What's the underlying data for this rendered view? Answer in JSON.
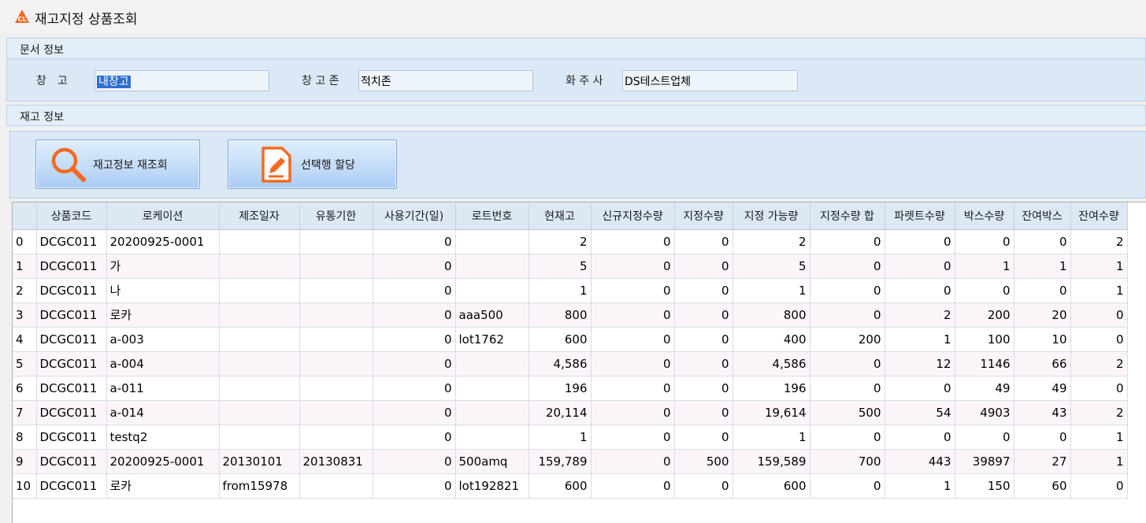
{
  "window": {
    "title": "재고지정 상품조회"
  },
  "doc_section": {
    "label": "문서 정보",
    "fields": [
      {
        "label": "창　고",
        "value": "내창고"
      },
      {
        "label": "창 고 존",
        "value": "적치존"
      },
      {
        "label": "화 주 사",
        "value": "DS테스트업체"
      }
    ]
  },
  "stock_section": {
    "label": "재고 정보",
    "buttons": {
      "requery": "재고정보 재조회",
      "assign": "선택행 할당"
    }
  },
  "colors": {
    "accent": "#f26a21",
    "selection": "#2d6fd2",
    "header_bg": "#dde8f5"
  },
  "table": {
    "columns": [
      "",
      "상품코드",
      "로케이션",
      "제조일자",
      "유통기한",
      "사용기간(일)",
      "로트번호",
      "현재고",
      "신규지정수량",
      "지정수량",
      "지정 가능량",
      "지정수량 합",
      "파렛트수량",
      "박스수량",
      "잔여박스",
      "잔여수량"
    ],
    "rows": [
      [
        "0",
        "DCGC011",
        "20200925-0001",
        "",
        "",
        "0",
        "",
        "2",
        "0",
        "0",
        "2",
        "0",
        "0",
        "0",
        "0",
        "2"
      ],
      [
        "1",
        "DCGC011",
        "가",
        "",
        "",
        "0",
        "",
        "5",
        "0",
        "0",
        "5",
        "0",
        "0",
        "1",
        "1",
        "1"
      ],
      [
        "2",
        "DCGC011",
        "나",
        "",
        "",
        "0",
        "",
        "1",
        "0",
        "0",
        "1",
        "0",
        "0",
        "0",
        "0",
        "1"
      ],
      [
        "3",
        "DCGC011",
        "로카",
        "",
        "",
        "0",
        "aaa500",
        "800",
        "0",
        "0",
        "800",
        "0",
        "2",
        "200",
        "20",
        "0"
      ],
      [
        "4",
        "DCGC011",
        "a-003",
        "",
        "",
        "0",
        "lot1762",
        "600",
        "0",
        "0",
        "400",
        "200",
        "1",
        "100",
        "10",
        "0"
      ],
      [
        "5",
        "DCGC011",
        "a-004",
        "",
        "",
        "0",
        "",
        "4,586",
        "0",
        "0",
        "4,586",
        "0",
        "12",
        "1146",
        "66",
        "2"
      ],
      [
        "6",
        "DCGC011",
        "a-011",
        "",
        "",
        "0",
        "",
        "196",
        "0",
        "0",
        "196",
        "0",
        "0",
        "49",
        "49",
        "0"
      ],
      [
        "7",
        "DCGC011",
        "a-014",
        "",
        "",
        "0",
        "",
        "20,114",
        "0",
        "0",
        "19,614",
        "500",
        "54",
        "4903",
        "43",
        "2"
      ],
      [
        "8",
        "DCGC011",
        "testq2",
        "",
        "",
        "0",
        "",
        "1",
        "0",
        "0",
        "1",
        "0",
        "0",
        "0",
        "0",
        "1"
      ],
      [
        "9",
        "DCGC011",
        "20200925-0001",
        "20130101",
        "20130831",
        "0",
        "500amq",
        "159,789",
        "0",
        "500",
        "159,589",
        "700",
        "443",
        "39897",
        "27",
        "1"
      ],
      [
        "10",
        "DCGC011",
        "로카",
        "from15978",
        "",
        "0",
        "lot192821",
        "600",
        "0",
        "0",
        "600",
        "0",
        "1",
        "150",
        "60",
        "0"
      ]
    ]
  }
}
